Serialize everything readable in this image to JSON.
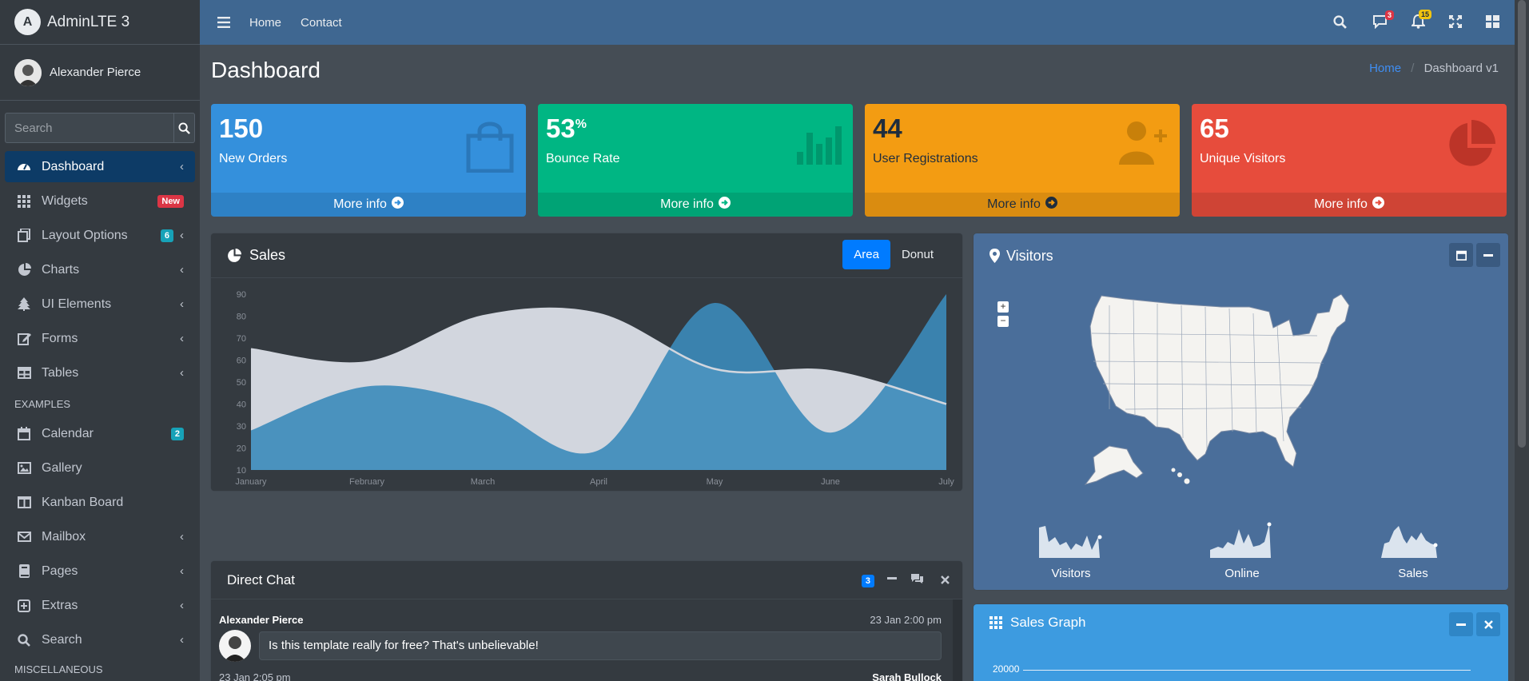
{
  "brand": {
    "name": "AdminLTE 3",
    "logo_letter": "A"
  },
  "user": {
    "name": "Alexander Pierce"
  },
  "search": {
    "placeholder": "Search"
  },
  "sidebar": {
    "items": [
      {
        "label": "Dashboard",
        "icon": "tachometer-icon",
        "active": true
      },
      {
        "label": "Widgets",
        "icon": "th-icon",
        "badge": "New"
      },
      {
        "label": "Layout Options",
        "icon": "copy-icon",
        "badge": "6"
      },
      {
        "label": "Charts",
        "icon": "chart-pie-icon"
      },
      {
        "label": "UI Elements",
        "icon": "tree-icon"
      },
      {
        "label": "Forms",
        "icon": "edit-icon"
      },
      {
        "label": "Tables",
        "icon": "table-icon"
      }
    ],
    "examples_header": "EXAMPLES",
    "examples": [
      {
        "label": "Calendar",
        "icon": "calendar-icon",
        "badge": "2"
      },
      {
        "label": "Gallery",
        "icon": "image-icon"
      },
      {
        "label": "Kanban Board",
        "icon": "columns-icon"
      },
      {
        "label": "Mailbox",
        "icon": "envelope-icon"
      },
      {
        "label": "Pages",
        "icon": "book-icon"
      },
      {
        "label": "Extras",
        "icon": "plus-square-icon"
      },
      {
        "label": "Search",
        "icon": "search-icon"
      }
    ],
    "misc_header": "MISCELLANEOUS"
  },
  "navbar": {
    "links": [
      "Home",
      "Contact"
    ],
    "messages_count": "3",
    "notifications_count": "15"
  },
  "page": {
    "title": "Dashboard",
    "breadcrumb_home": "Home",
    "breadcrumb_current": "Dashboard v1"
  },
  "boxes": [
    {
      "value": "150",
      "suffix": "",
      "label": "New Orders",
      "color": "#3490dc",
      "icon": "shopping-bag-icon",
      "link": "More info"
    },
    {
      "value": "53",
      "suffix": "%",
      "label": "Bounce Rate",
      "color": "#00b683",
      "icon": "bar-chart-icon",
      "link": "More info"
    },
    {
      "value": "44",
      "suffix": "",
      "label": "User Registrations",
      "color": "#f39c12",
      "icon": "user-plus-icon",
      "link": "More info"
    },
    {
      "value": "65",
      "suffix": "",
      "label": "Unique Visitors",
      "color": "#e74c3c",
      "icon": "pie-chart-icon",
      "link": "More info"
    }
  ],
  "sales": {
    "title": "Sales",
    "tabs": [
      "Area",
      "Donut"
    ],
    "active_tab": "Area"
  },
  "visitors": {
    "title": "Visitors",
    "sparklines": [
      {
        "label": "Visitors"
      },
      {
        "label": "Online"
      },
      {
        "label": "Sales"
      }
    ]
  },
  "direct_chat": {
    "title": "Direct Chat",
    "badge": "3",
    "messages": [
      {
        "name": "Alexander Pierce",
        "time": "23 Jan 2:00 pm",
        "text": "Is this template really for free? That's unbelievable!"
      },
      {
        "name": "Sarah Bullock",
        "time": "23 Jan 2:05 pm",
        "text": ""
      }
    ]
  },
  "sales_graph": {
    "title": "Sales Graph",
    "first_tick": "20000"
  },
  "chart_data": {
    "type": "area",
    "categories": [
      "January",
      "February",
      "March",
      "April",
      "May",
      "June",
      "July"
    ],
    "series": [
      {
        "values": [
          28,
          48,
          40,
          19,
          86,
          27,
          90
        ],
        "color": "#3b8bba"
      },
      {
        "values": [
          65,
          59,
          80,
          81,
          56,
          55,
          40
        ],
        "color": "#d2d6de"
      }
    ],
    "ylim": [
      10,
      90
    ],
    "yticks": [
      10,
      20,
      30,
      40,
      50,
      60,
      70,
      80,
      90
    ]
  }
}
